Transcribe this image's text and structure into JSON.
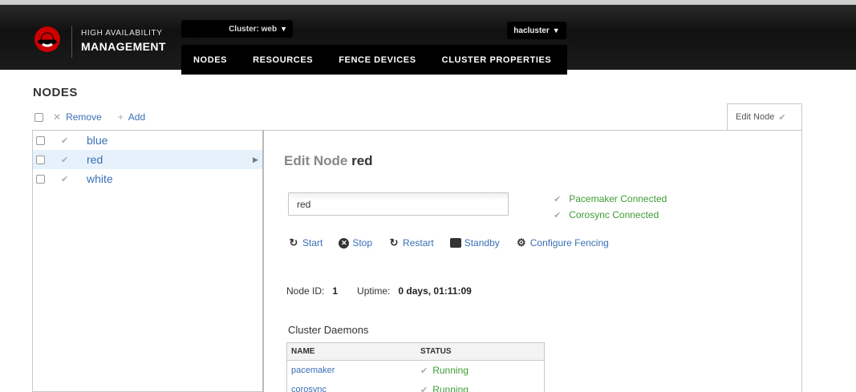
{
  "header": {
    "brand_line1": "HIGH AVAILABILITY",
    "brand_line2": "MANAGEMENT",
    "cluster_select": "Cluster: web",
    "user_menu": "hacluster",
    "nav": [
      "NODES",
      "RESOURCES",
      "FENCE DEVICES",
      "CLUSTER PROPERTIES"
    ]
  },
  "nodes_page": {
    "title": "NODES",
    "remove_label": "Remove",
    "add_label": "Add",
    "nodes": [
      "blue",
      "red",
      "white"
    ],
    "selected_node": "red"
  },
  "edit_node": {
    "tab_label": "Edit Node",
    "title_prefix": "Edit Node",
    "title_node": "red",
    "name_value": "red",
    "statuses": [
      "Pacemaker Connected",
      "Corosync Connected"
    ],
    "actions": [
      "Start",
      "Stop",
      "Restart",
      "Standby",
      "Configure Fencing"
    ],
    "node_id_label": "Node ID:",
    "node_id_value": "1",
    "uptime_label": "Uptime:",
    "uptime_value": "0 days, 01:11:09",
    "daemons_title": "Cluster Daemons",
    "table_headers": [
      "NAME",
      "STATUS"
    ],
    "daemons": [
      {
        "name": "pacemaker",
        "status": "Running"
      },
      {
        "name": "corosync",
        "status": "Running"
      }
    ]
  },
  "colors": {
    "link": "#3a6fb6",
    "ok_green": "#3f9c35",
    "selected_row": "#e6f1fb",
    "header_bg": "#111111"
  }
}
